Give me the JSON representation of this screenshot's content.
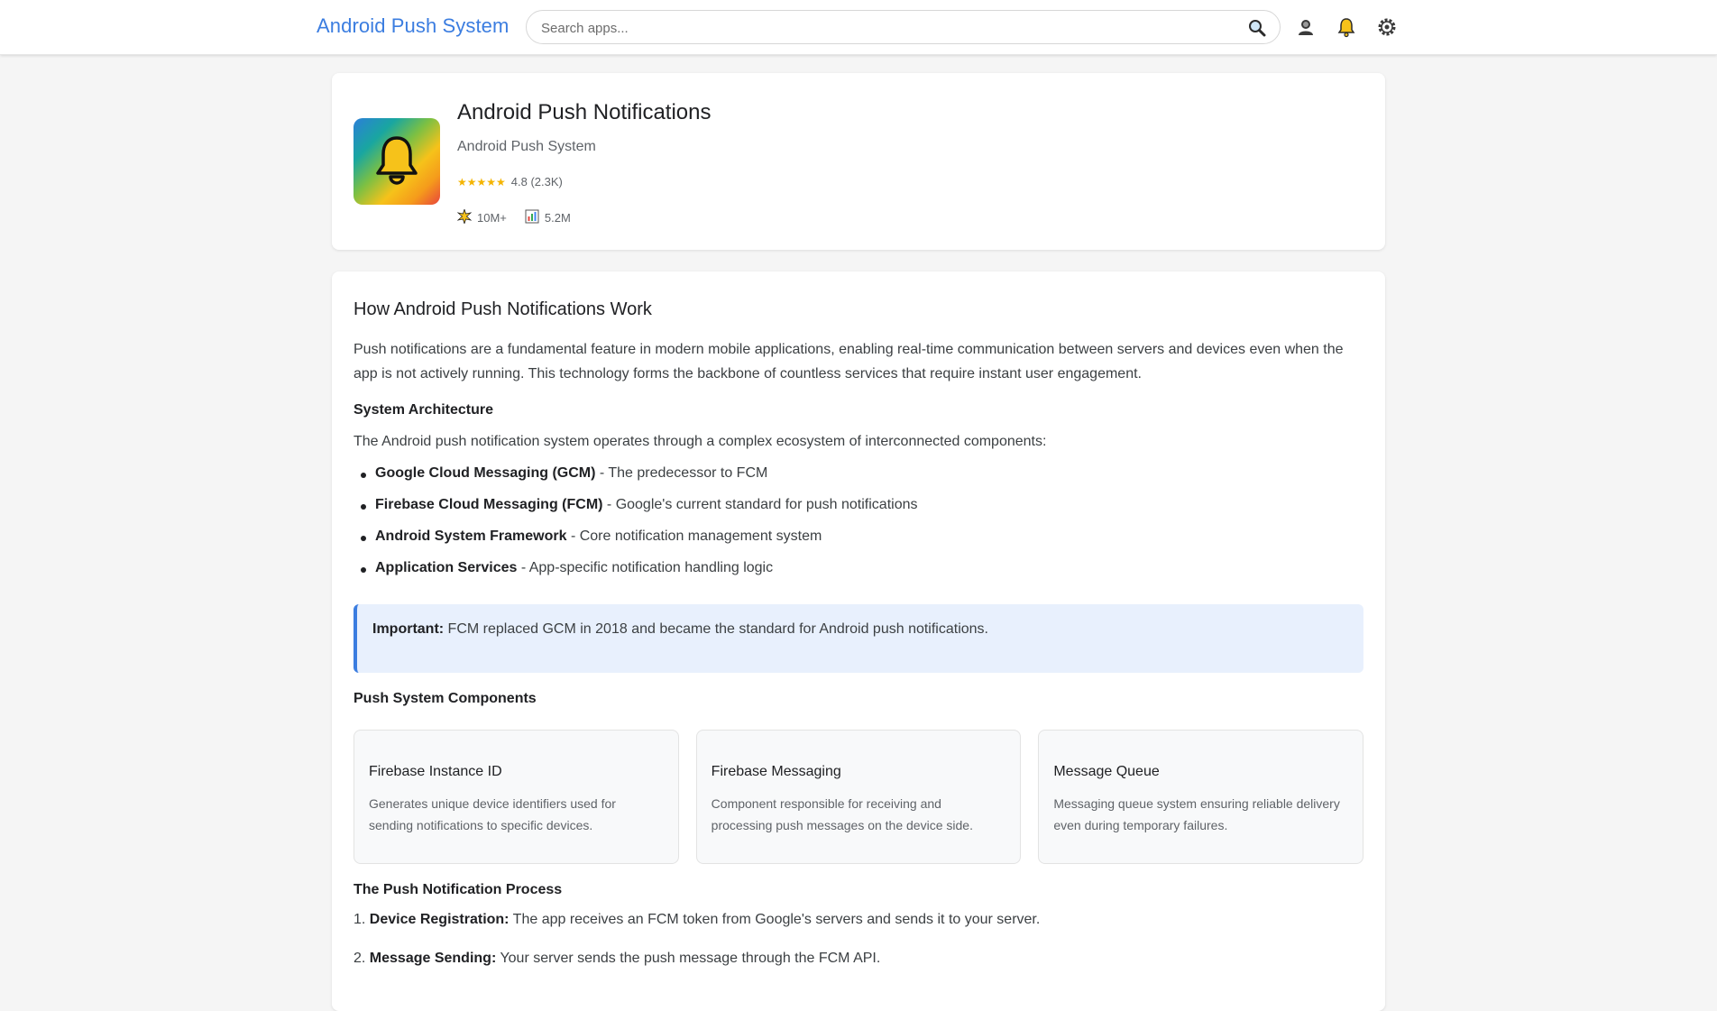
{
  "header": {
    "brand": "Android Push System",
    "search_placeholder": "Search apps...",
    "icons": [
      "search-icon",
      "account-icon",
      "notification-bell-icon",
      "settings-gear-icon"
    ]
  },
  "app": {
    "title": "Android Push Notifications",
    "developer": "Android Push System",
    "stars": "★★★★★",
    "rating": "4.8 (2.3K)",
    "downloads": "10M+",
    "active_users": "5.2M"
  },
  "article": {
    "heading": "How Android Push Notifications Work",
    "intro": "Push notifications are a fundamental feature in modern mobile applications, enabling real-time communication between servers and devices even when the app is not actively running. This technology forms the backbone of countless services that require instant user engagement.",
    "architecture_heading": "System Architecture",
    "architecture_intro": "The Android push notification system operates through a complex ecosystem of interconnected components:",
    "bullets": [
      {
        "term": "Google Cloud Messaging (GCM)",
        "desc": " - The predecessor to FCM"
      },
      {
        "term": "Firebase Cloud Messaging (FCM)",
        "desc": " - Google's current standard for push notifications"
      },
      {
        "term": "Android System Framework",
        "desc": " - Core notification management system"
      },
      {
        "term": "Application Services",
        "desc": " - App-specific notification handling logic"
      }
    ],
    "callout": {
      "label": "Important:",
      "text": " FCM replaced GCM in 2018 and became the standard for Android push notifications."
    },
    "components_heading": "Push System Components",
    "components": [
      {
        "title": "Firebase Instance ID",
        "desc": "Generates unique device identifiers used for sending notifications to specific devices."
      },
      {
        "title": "Firebase Messaging",
        "desc": "Component responsible for receiving and processing push messages on the device side."
      },
      {
        "title": "Message Queue",
        "desc": "Messaging queue system ensuring reliable delivery even during temporary failures."
      }
    ],
    "process_heading": "The Push Notification Process",
    "steps": [
      {
        "num": "1. ",
        "term": "Device Registration:",
        "desc": " The app receives an FCM token from Google's servers and sends it to your server."
      },
      {
        "num": "2. ",
        "term": "Message Sending:",
        "desc": " Your server sends the push message through the FCM API."
      }
    ]
  }
}
